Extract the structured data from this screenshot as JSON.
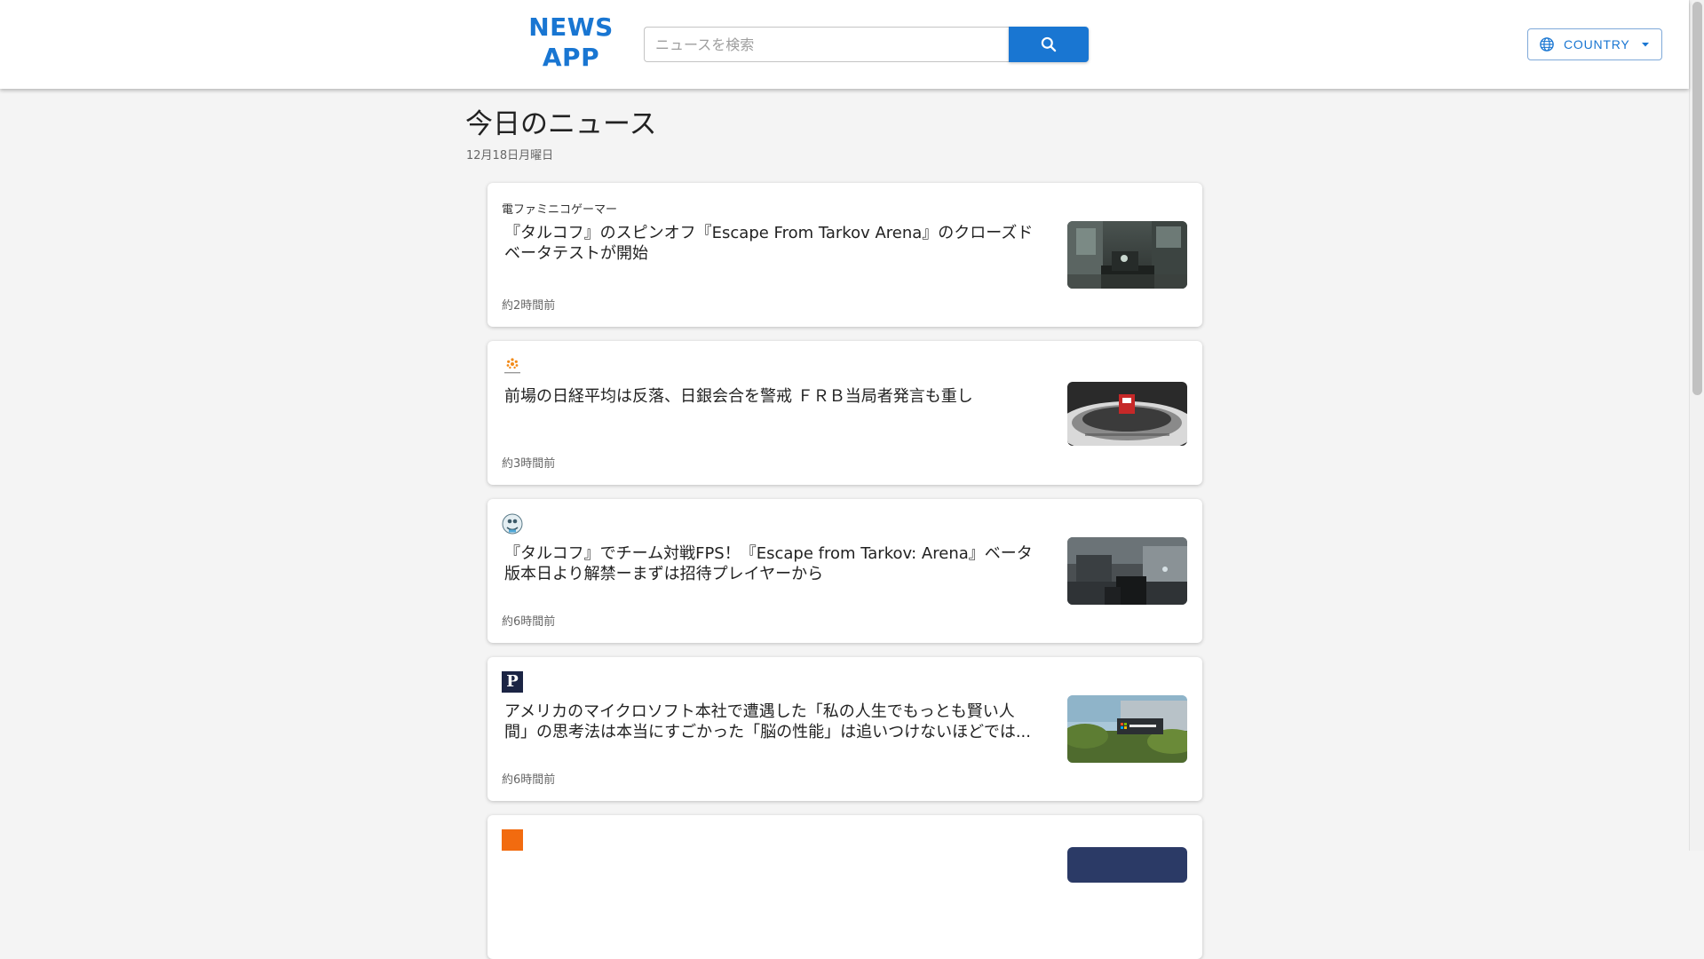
{
  "header": {
    "logo_line1": "NEWS",
    "logo_line2": "APP",
    "search_placeholder": "ニュースを検索",
    "search_value": "",
    "country_label": "COUNTRY"
  },
  "main": {
    "title": "今日のニュース",
    "date": "12月18日月曜日"
  },
  "articles": [
    {
      "source": "電ファミニコゲーマー",
      "title": "『タルコフ』のスピンオフ『Escape From Tarkov Arena』のクローズドベータテストが開始",
      "time": "約2時間前",
      "thumbnail": "fps-game-scene"
    },
    {
      "source_logo": "reuters-logo",
      "title": "前場の日経平均は反落、日銀会合を警戒 ＦＲＢ当局者発言も重し",
      "time": "約3時間前",
      "thumbnail": "japan-exchange-group"
    },
    {
      "source_logo": "round-avatar-logo",
      "title": "『タルコフ』でチーム対戦FPS！『Escape from Tarkov: Arena』ベータ版本日より解禁ーまずは招待プレイヤーから",
      "time": "約6時間前",
      "thumbnail": "fps-arena-scene"
    },
    {
      "source_logo": "P",
      "title": "アメリカのマイクロソフト本社で遭遇した「私の人生でもっとも賢い人間」の思考法は本当にすごかった「脳の性能」は追いつけないほどでは...",
      "time": "約6時間前",
      "thumbnail": "microsoft-sign"
    },
    {
      "source_logo": "orange-square-logo",
      "title": "",
      "time": "",
      "thumbnail": "partial"
    }
  ],
  "colors": {
    "accent": "#1976d2",
    "background": "#f4f4f4",
    "card": "#ffffff"
  },
  "icons": {
    "search_button": "search-icon",
    "country_button_left": "globe-icon",
    "country_button_right": "caret-down-icon"
  }
}
